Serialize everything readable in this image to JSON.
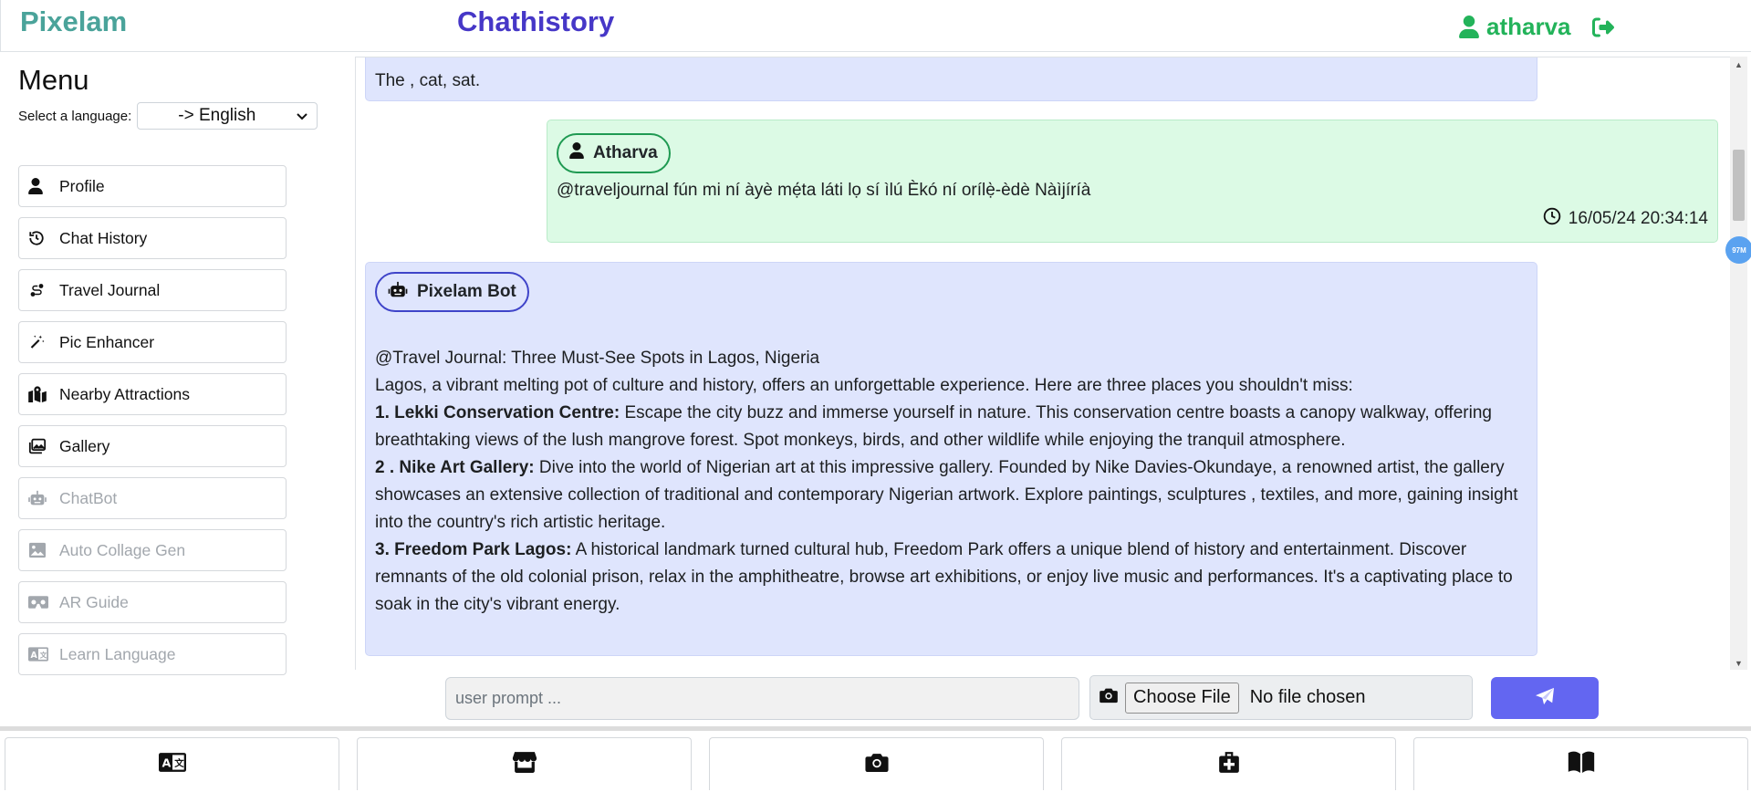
{
  "app": {
    "brand": "Pixelam",
    "page_title": "Chathistory",
    "username": "atharva"
  },
  "sidebar": {
    "menu_title": "Menu",
    "language_label": "Select a language:",
    "language_selected": "-> English",
    "items": [
      {
        "label": "Profile",
        "icon": "user-icon",
        "enabled": true
      },
      {
        "label": "Chat History",
        "icon": "history-icon",
        "enabled": true
      },
      {
        "label": "Travel Journal",
        "icon": "route-icon",
        "enabled": true
      },
      {
        "label": "Pic Enhancer",
        "icon": "magic-wand-icon",
        "enabled": true
      },
      {
        "label": "Nearby Attractions",
        "icon": "map-location-icon",
        "enabled": true
      },
      {
        "label": "Gallery",
        "icon": "images-icon",
        "enabled": true
      },
      {
        "label": "ChatBot",
        "icon": "robot-icon",
        "enabled": false
      },
      {
        "label": "Auto Collage Gen",
        "icon": "image-icon",
        "enabled": false
      },
      {
        "label": "AR Guide",
        "icon": "vr-cardboard-icon",
        "enabled": false
      },
      {
        "label": "Learn Language",
        "icon": "language-icon",
        "enabled": false
      }
    ]
  },
  "chat": {
    "partial_message": "The , cat, sat.",
    "user_message": {
      "sender": "Atharva",
      "text": "@traveljournal fún mi ní àyè mẹ́ta láti lọ sí ìlú Èkó ní orílẹ̀-èdè Nàìjíríà",
      "timestamp": "16/05/24 20:34:14"
    },
    "bot_message": {
      "sender": "Pixelam Bot",
      "heading": "@Travel Journal: Three Must-See Spots in Lagos, Nigeria",
      "intro": "Lagos, a vibrant melting pot of culture and history, offers an unforgettable experience. Here are three places you shouldn't miss:",
      "items": [
        {
          "title": "1. Lekki Conservation Centre:",
          "text": " Escape the city buzz and immerse yourself in nature. This conservation centre boasts a canopy walkway, offering breathtaking views of the lush mangrove forest. Spot monkeys, birds, and other wildlife while enjoying the tranquil atmosphere."
        },
        {
          "title": "2 . Nike Art Gallery:",
          "text": " Dive into the world of Nigerian art at this impressive gallery. Founded by Nike Davies-Okundaye, a renowned artist, the gallery showcases an extensive collection of traditional and contemporary Nigerian artwork. Explore paintings, sculptures , textiles, and more, gaining insight into the country's rich artistic heritage."
        },
        {
          "title": "3. Freedom Park Lagos:",
          "text": " A historical landmark turned cultural hub, Freedom Park offers a unique blend of history and entertainment. Discover remnants of the old colonial prison, relax in the amphitheatre, browse art exhibitions, or enjoy live music and performances. It's a captivating place to soak in the city's vibrant energy."
        }
      ]
    },
    "badge": "97M"
  },
  "composer": {
    "placeholder": "user prompt ...",
    "file_button": "Choose File",
    "file_status": "No file chosen"
  },
  "bottom_bar": {
    "buttons": [
      "language-icon",
      "store-icon",
      "camera-icon",
      "suitcase-medical-icon",
      "book-icon"
    ]
  },
  "colors": {
    "brand": "#4aa39a",
    "title": "#4637c7",
    "user_green": "#23b35a",
    "bot_bubble": "#dfe5fd",
    "user_bubble": "#dcfae5",
    "send_button": "#6366f1"
  }
}
